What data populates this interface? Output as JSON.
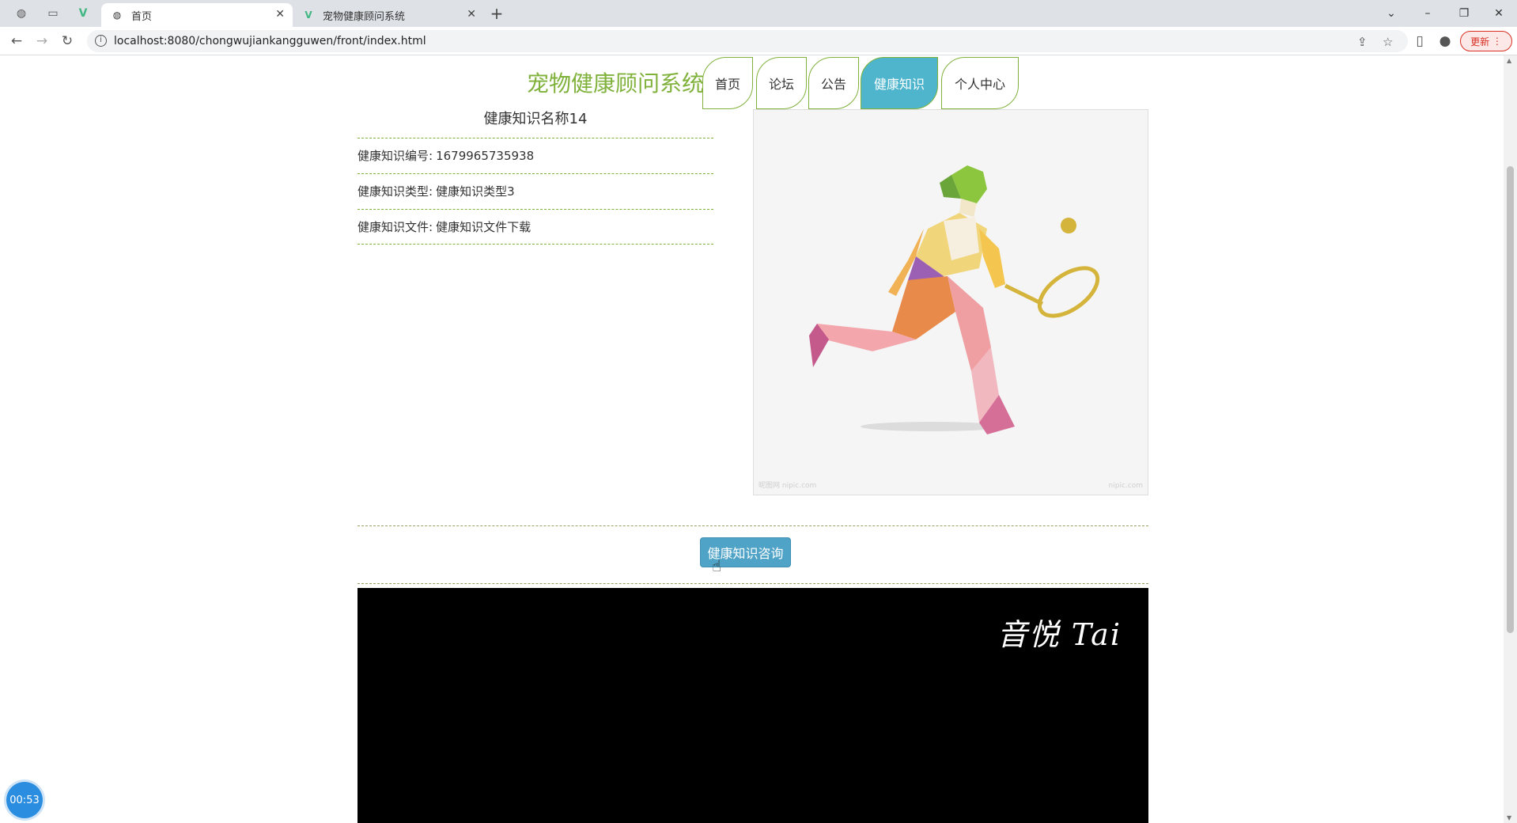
{
  "browser": {
    "tabs": [
      {
        "title": "首页",
        "favicon": "globe-icon",
        "active": true
      },
      {
        "title": "宠物健康顾问系统",
        "favicon": "vue-icon",
        "active": false
      }
    ],
    "url": "localhost:8080/chongwujiankangguwen/front/index.html",
    "update_label": "更新"
  },
  "site": {
    "title": "宠物健康顾问系统",
    "nav": [
      {
        "label": "首页",
        "active": false
      },
      {
        "label": "论坛",
        "active": false
      },
      {
        "label": "公告",
        "active": false
      },
      {
        "label": "健康知识",
        "active": true
      },
      {
        "label": "个人中心",
        "active": false
      }
    ]
  },
  "detail": {
    "title": "健康知识名称14",
    "fields": [
      {
        "label": "健康知识编号:",
        "value": "1679965735938"
      },
      {
        "label": "健康知识类型:",
        "value": "健康知识类型3"
      },
      {
        "label": "健康知识文件:",
        "value": "健康知识文件下载"
      }
    ],
    "image_description": "polygon-style tennis player illustration",
    "consult_button": "健康知识咨询"
  },
  "video": {
    "watermark": "音悦 Tai"
  },
  "recording_timer": "00:53",
  "colors": {
    "accent_green": "#7fb13b",
    "active_tab": "#4fb5cd",
    "button_blue": "#4fa3c7"
  }
}
